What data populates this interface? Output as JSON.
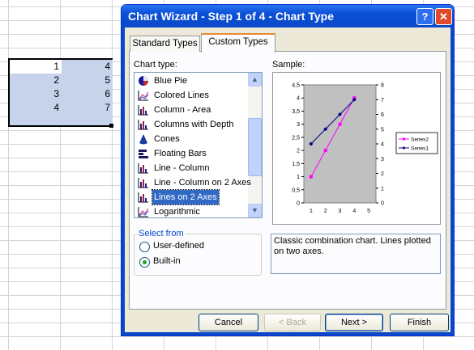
{
  "spreadsheet": {
    "rows": [
      {
        "a": "1",
        "b": "4"
      },
      {
        "a": "2",
        "b": "5"
      },
      {
        "a": "3",
        "b": "6"
      },
      {
        "a": "4",
        "b": "7"
      }
    ]
  },
  "dialog": {
    "title": "Chart Wizard - Step 1 of 4 - Chart Type",
    "help_glyph": "?",
    "close_glyph": "✕",
    "tabs": {
      "standard": "Standard Types",
      "custom": "Custom Types"
    },
    "chart_type_label": "Chart type:",
    "sample_label": "Sample:",
    "chart_types": [
      {
        "label": "Blue Pie",
        "icon": "pie-icon"
      },
      {
        "label": "Colored Lines",
        "icon": "line-chart-icon"
      },
      {
        "label": "Column - Area",
        "icon": "column-chart-icon"
      },
      {
        "label": "Columns with Depth",
        "icon": "column-chart-icon"
      },
      {
        "label": "Cones",
        "icon": "cone-icon"
      },
      {
        "label": "Floating Bars",
        "icon": "bar-chart-icon"
      },
      {
        "label": "Line - Column",
        "icon": "column-chart-icon"
      },
      {
        "label": "Line - Column on 2 Axes",
        "icon": "column-chart-icon"
      },
      {
        "label": "Lines on 2 Axes",
        "icon": "column-chart-icon",
        "selected": true
      },
      {
        "label": "Logarithmic",
        "icon": "line-chart-icon"
      }
    ],
    "description": "Classic combination chart. Lines plotted on two axes.",
    "select_from": {
      "title": "Select from",
      "user_defined": "User-defined",
      "built_in": "Built-in",
      "selected": "built_in"
    },
    "buttons": {
      "cancel": "Cancel",
      "back": "< Back",
      "next": "Next >",
      "finish": "Finish"
    },
    "accent_color": "#316ac5",
    "title_color": "#0a4fd6"
  },
  "chart_data": {
    "type": "line",
    "x": [
      1,
      2,
      3,
      4
    ],
    "x_ticks": [
      "1",
      "2",
      "3",
      "4",
      "5"
    ],
    "y_left_ticks": [
      "0",
      "0,5",
      "1",
      "1,5",
      "2",
      "2,5",
      "3",
      "3,5",
      "4",
      "4,5"
    ],
    "y_right_ticks": [
      "0",
      "1",
      "2",
      "3",
      "4",
      "5",
      "6",
      "7",
      "8"
    ],
    "ylim_left": [
      0,
      4.5
    ],
    "ylim_right": [
      0,
      8
    ],
    "series": [
      {
        "name": "Series2",
        "axis": "left",
        "values": [
          1,
          2,
          3,
          4
        ],
        "color": "#ff00ff",
        "marker": "square"
      },
      {
        "name": "Series1",
        "axis": "right",
        "values": [
          4,
          5,
          6,
          7
        ],
        "color": "#000080",
        "marker": "diamond"
      }
    ],
    "plot_background": "#c0c0c0",
    "legend": "right"
  }
}
